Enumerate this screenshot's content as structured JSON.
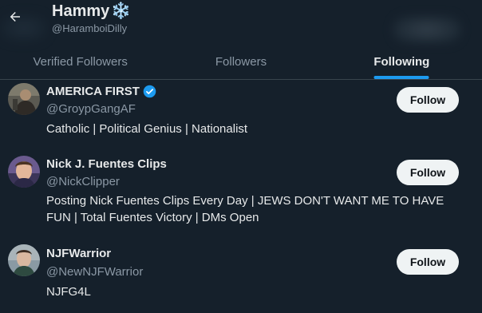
{
  "header": {
    "back_icon": "arrow-left-icon",
    "title": "Hammy",
    "title_emoji": "❄️",
    "handle": "@HaramboiDilly"
  },
  "tabs": [
    {
      "label": "Verified Followers",
      "active": false
    },
    {
      "label": "Followers",
      "active": false
    },
    {
      "label": "Following",
      "active": true
    }
  ],
  "users": [
    {
      "name": "AMERICA FIRST",
      "verified": true,
      "handle": "@GroypGangAF",
      "bio": "Catholic | Political Genius | Nationalist",
      "follow_label": "Follow"
    },
    {
      "name": "Nick J. Fuentes Clips",
      "verified": false,
      "handle": "@NickClipper",
      "bio": "Posting Nick Fuentes Clips Every Day | JEWS DON'T WANT ME TO HAVE FUN | Total Fuentes Victory | DMs Open",
      "follow_label": "Follow"
    },
    {
      "name": "NJFWarrior",
      "verified": false,
      "handle": "@NewNJFWarrior",
      "bio": "NJFG4L",
      "follow_label": "Follow"
    }
  ],
  "colors": {
    "background": "#15202b",
    "accent": "#1d9bf0",
    "text_primary": "#e7e9ea",
    "text_secondary": "#8b98a5",
    "button_bg": "#eff3f4"
  }
}
